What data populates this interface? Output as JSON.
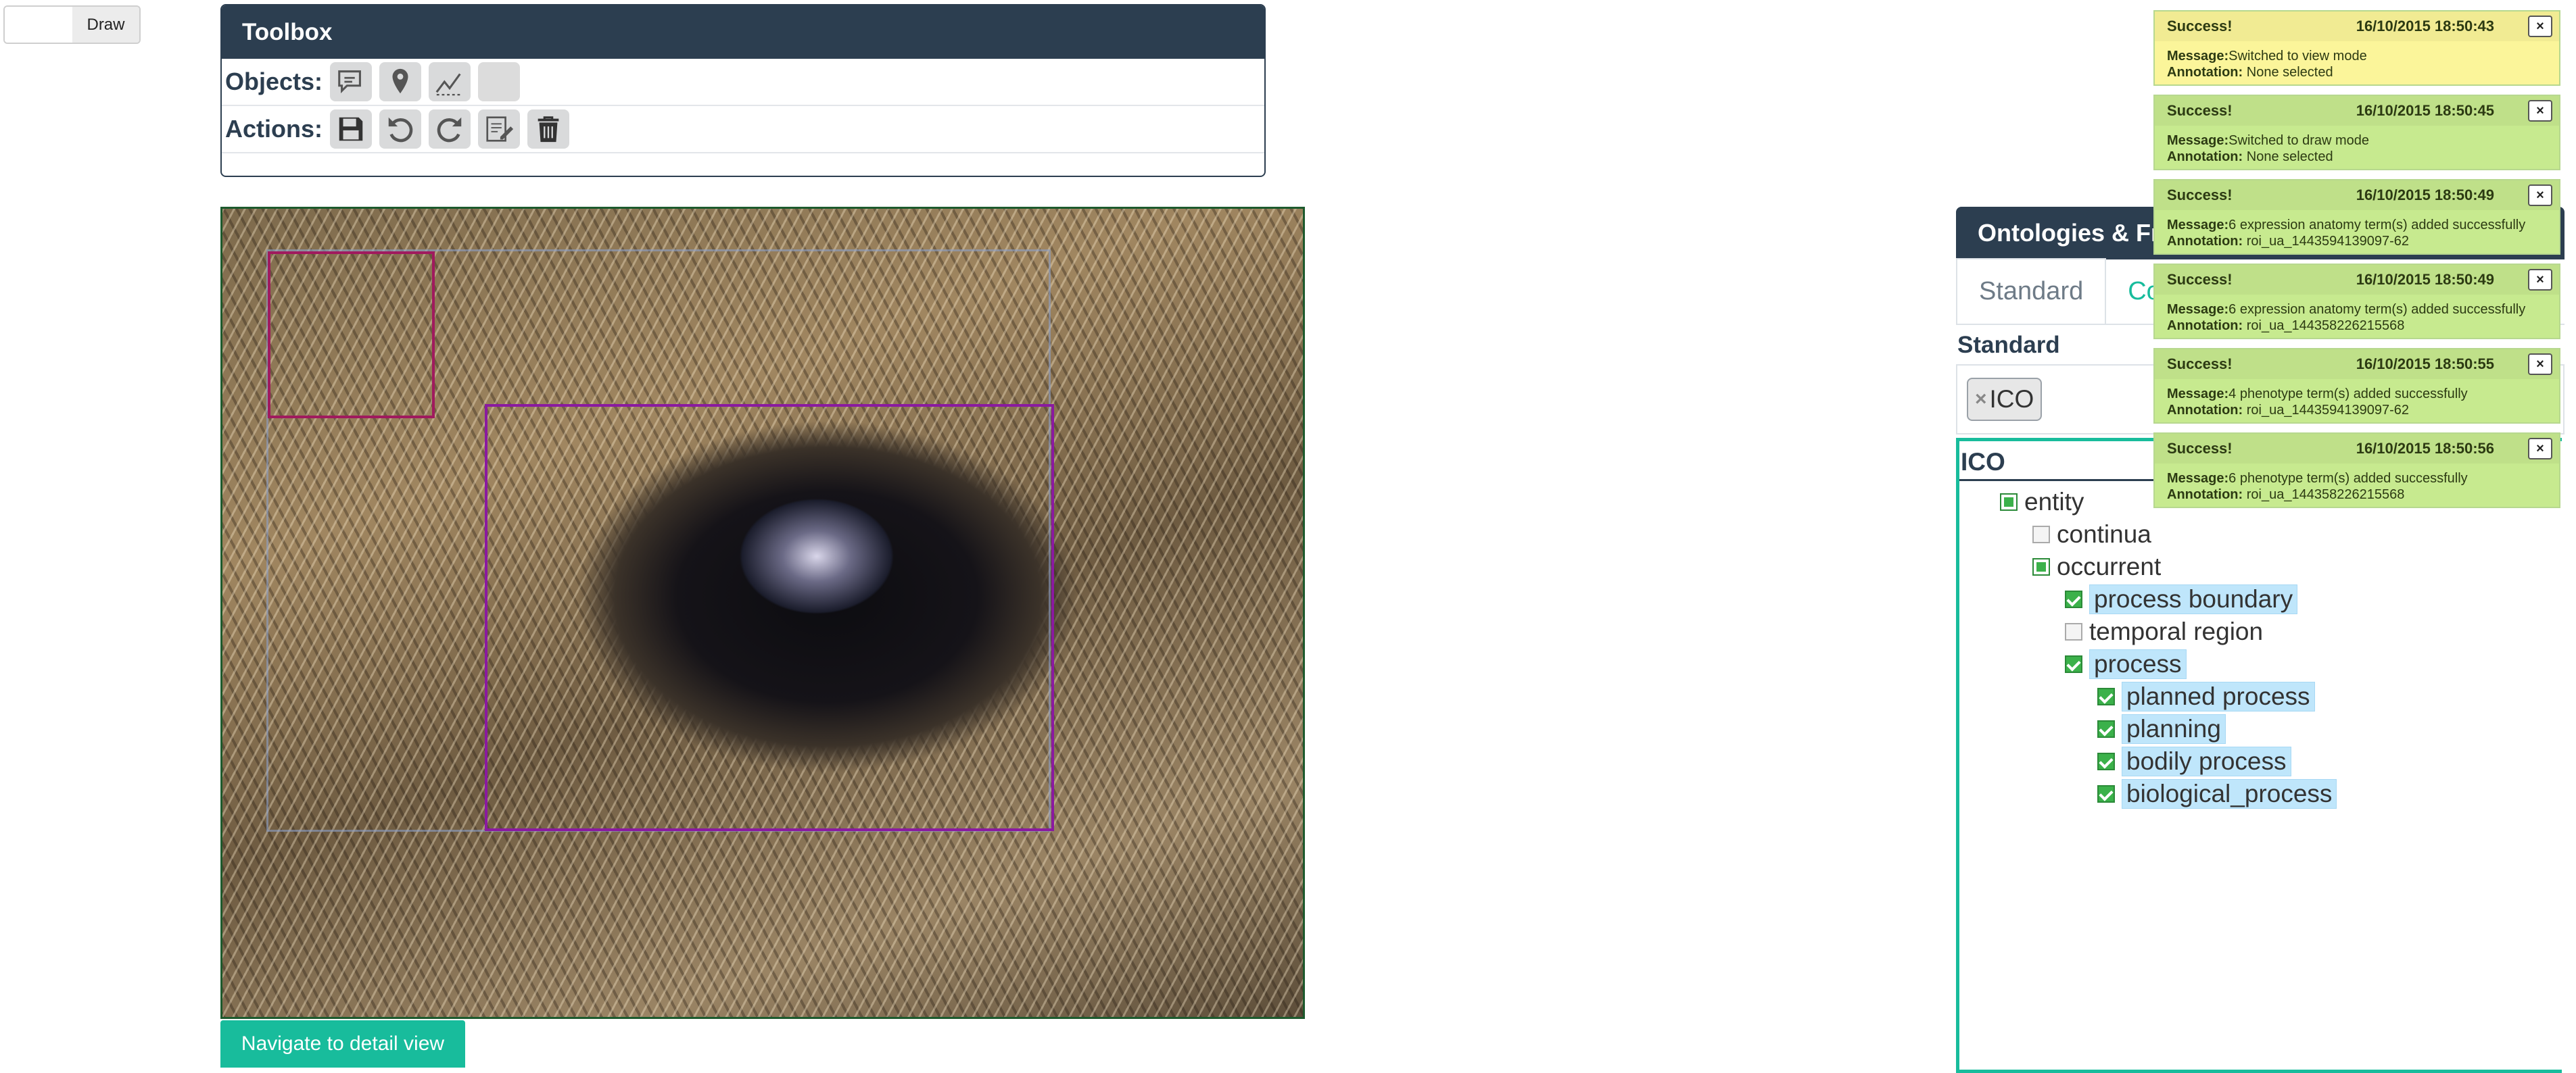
{
  "toggle": {
    "label": "Draw"
  },
  "toolbox": {
    "title": "Toolbox",
    "objects_label": "Objects:",
    "actions_label": "Actions:",
    "objects": [
      "comment-icon",
      "map-marker-icon",
      "polyline-icon",
      "blank-icon"
    ],
    "actions": [
      "save-icon",
      "undo-icon",
      "redo-icon",
      "edit-icon",
      "trash-icon"
    ]
  },
  "image": {
    "subject": "mouse-eye",
    "roi_count": 3
  },
  "navigate_button": "Navigate to detail view",
  "ontology": {
    "title": "Ontologies & Fr",
    "tabs": [
      "Standard",
      "Co"
    ],
    "section_label": "Standard",
    "selected_chip": "ICO",
    "tree_title": "ICO",
    "nodes": [
      {
        "label": "entity",
        "state": "partial"
      },
      {
        "label": "continua",
        "state": "off"
      },
      {
        "label": "occurrent",
        "state": "partial"
      },
      {
        "label": "process boundary",
        "state": "on"
      },
      {
        "label": "temporal region",
        "state": "off"
      },
      {
        "label": "process",
        "state": "on"
      },
      {
        "label": "planned process",
        "state": "on"
      },
      {
        "label": "planning",
        "state": "on"
      },
      {
        "label": "bodily process",
        "state": "on"
      },
      {
        "label": "biological_process",
        "state": "on"
      }
    ]
  },
  "notifications": [
    {
      "title": "Success!",
      "date": "16/10/2015 18:50:43",
      "message": "Switched to view mode",
      "annotation": "None selected",
      "color": "#fbf59a"
    },
    {
      "title": "Success!",
      "date": "16/10/2015 18:50:45",
      "message": "Switched to draw mode",
      "annotation": "None selected",
      "color": "#c7ea8f"
    },
    {
      "title": "Success!",
      "date": "16/10/2015 18:50:49",
      "message": "6 expression anatomy term(s) added successfully",
      "annotation": "roi_ua_1443594139097-62",
      "color": "#c7ea8f"
    },
    {
      "title": "Success!",
      "date": "16/10/2015 18:50:49",
      "message": "6 expression anatomy term(s) added successfully",
      "annotation": "roi_ua_144358226215568",
      "color": "#c7ea8f"
    },
    {
      "title": "Success!",
      "date": "16/10/2015 18:50:55",
      "message": "4 phenotype term(s) added successfully",
      "annotation": "roi_ua_1443594139097-62",
      "color": "#c7ea8f"
    },
    {
      "title": "Success!",
      "date": "16/10/2015 18:50:56",
      "message": "6 phenotype term(s) added successfully",
      "annotation": "roi_ua_144358226215568",
      "color": "#c7ea8f"
    }
  ],
  "labels": {
    "message": "Message:",
    "annotation": "Annotation:"
  }
}
